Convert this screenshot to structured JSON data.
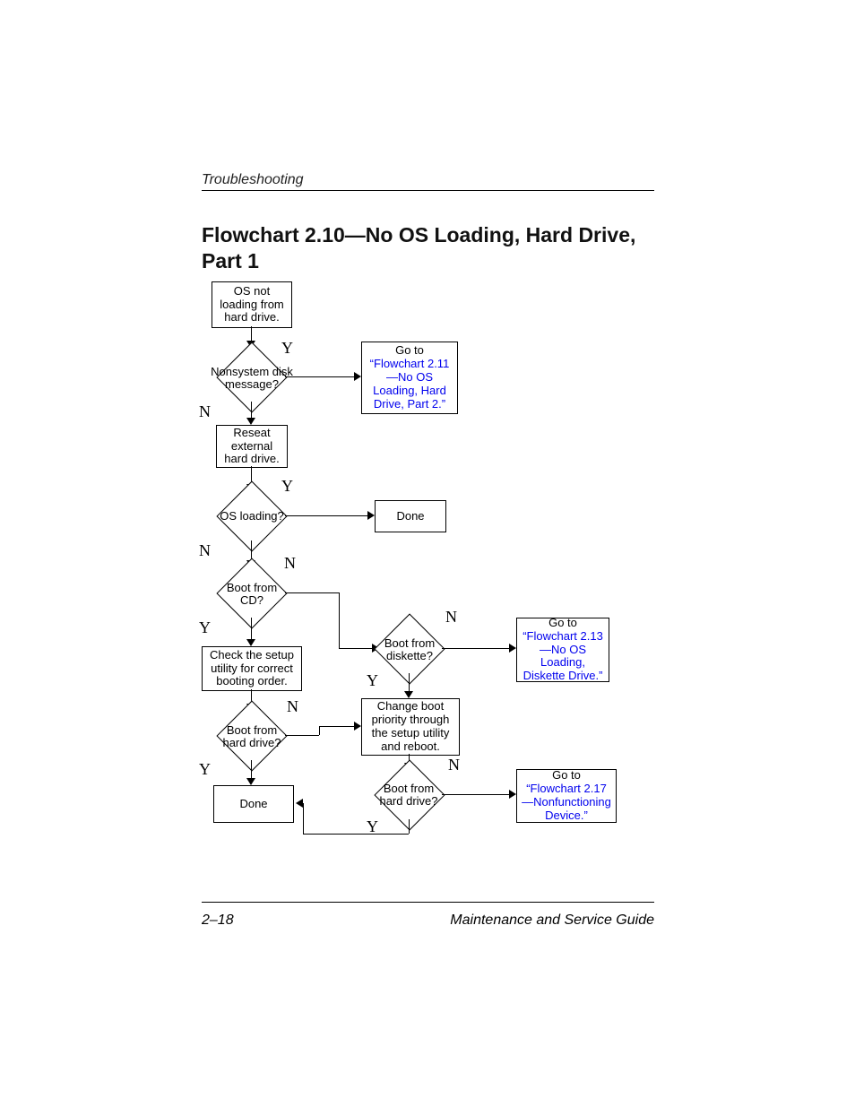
{
  "header": "Troubleshooting",
  "title": "Flowchart 2.10—No OS Loading, Hard Drive, Part 1",
  "footer_left": "2–18",
  "footer_right": "Maintenance and Service Guide",
  "nodes": {
    "start": "OS not loading from hard drive.",
    "d1": "Nonsystem disk message?",
    "ref1_a": "Go to",
    "ref1_b": "“Flowchart 2.11—No OS Loading, Hard Drive, Part 2.”",
    "reseat": "Reseat external hard drive.",
    "d2": "OS loading?",
    "done1": "Done",
    "d3": "Boot from CD?",
    "check": "Check the setup utility for correct booting order.",
    "d4": "Boot from diskette?",
    "ref2_a": "Go to",
    "ref2_b": "“Flowchart 2.13—No OS Loading, Diskette Drive.”",
    "d5": "Boot from hard drive?",
    "change": "Change boot priority through the setup utility and reboot.",
    "d6": "Boot from hard drive?",
    "ref3_a": "Go to",
    "ref3_b": "“Flowchart 2.17—Nonfunctioning Device.”",
    "done2": "Done"
  },
  "labels": {
    "Y": "Y",
    "N": "N"
  }
}
